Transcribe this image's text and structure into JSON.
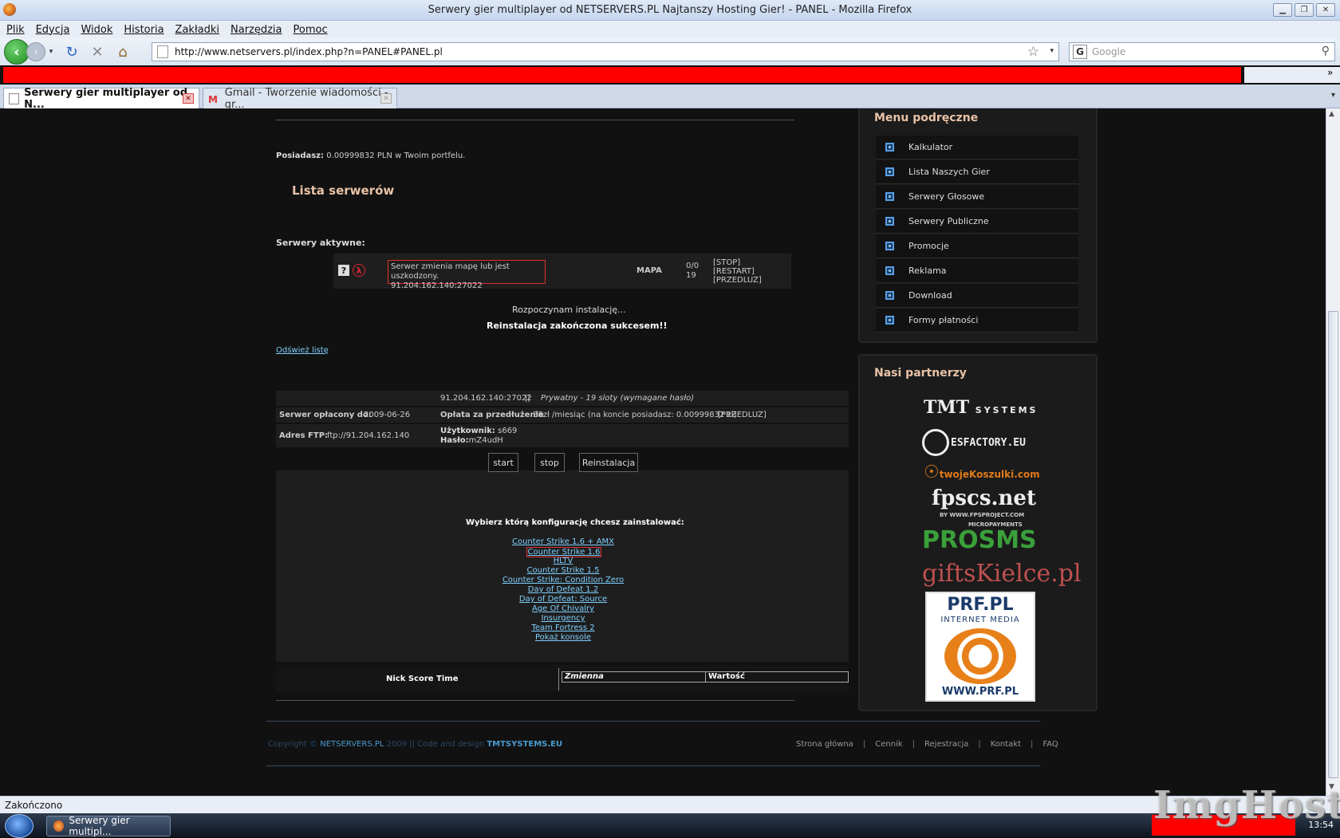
{
  "window": {
    "title": "Serwery gier multiplayer od NETSERVERS.PL Najtanszy Hosting Gier! - PANEL - Mozilla Firefox",
    "minimize": "▁",
    "maximize": "❐",
    "close": "✕"
  },
  "menu": [
    "Plik",
    "Edycja",
    "Widok",
    "Historia",
    "Zakładki",
    "Narzędzia",
    "Pomoc"
  ],
  "nav": {
    "url": "http://www.netservers.pl/index.php?n=PANEL#PANEL.pl",
    "search_placeholder": "Google",
    "bookmarks_overflow": "»"
  },
  "tabs": [
    {
      "label": "Serwery gier multiplayer od N...",
      "active": true
    },
    {
      "label": "Gmail - Tworzenie wiadomości - gr...",
      "active": false
    }
  ],
  "page": {
    "posiadasz_label": "Posiadasz:",
    "posiadasz_value": "0.00999832 PLN w Twoim portfelu.",
    "lista_title": "Lista serwerów",
    "aktywne_label": "Serwery aktywne:",
    "server": {
      "status_line1": "Serwer zmienia mapę lub jest uszkodzony.",
      "status_line2": "91.204.162.140:27022",
      "map": "MAPA",
      "players": "0/0",
      "slots": "19",
      "stop": "[STOP]",
      "restart": "[RESTART]",
      "przedluz": "[PRZEDLUZ]"
    },
    "installing": "Rozpoczynam instalację...",
    "success": "Reinstalacja zakończona sukcesem!!",
    "refresh": "Odśwież listę",
    "info": {
      "address": "91.204.162.140:27022",
      "sep": "||",
      "type": "Prywatny - 19 sloty (wymagane hasło)",
      "paid_label": "Serwer opłacony do:",
      "paid_value": "2009-06-26",
      "fee_label": "Opłata za przedłużenie",
      "fee_value": "38zł /miesiąc (na koncie posiadasz: 0.00999832 zł)",
      "fee_extend": "[PRZEDLUZ]",
      "ftp_label": "Adres FTP:",
      "ftp_value": "ftp://91.204.162.140",
      "user_label": "Użytkownik:",
      "user_value": "s669",
      "pass_label": "Hasło:",
      "pass_value": "mZ4udH"
    },
    "buttons": {
      "start": "start",
      "stop": "stop",
      "reinstall": "Reinstalacja"
    },
    "config_title": "Wybierz którą konfigurację chcesz zainstalować:",
    "configs": [
      "Counter Strike 1.6 + AMX",
      "Counter Strike 1.6",
      "HLTV",
      "Counter Strike 1.5",
      "Counter Strike: Condition Zero",
      "Day of Defeat 1.2",
      "Day of Defeat: Source",
      "Age Of Chivalry",
      "Insurgency",
      "Team Fortress 2",
      "Pokaż konsole"
    ],
    "selected_config": "Counter Strike 1.6",
    "table_left": "Nick Score Time",
    "table_col1": "Zmienna",
    "table_col2": "Wartość",
    "footer": {
      "copy_prefix": "Copyright ©",
      "brand": "NETSERVERS.PL",
      "year_text": "2009 || Code and design",
      "designer": "TMTSYSTEMS.EU",
      "links": [
        "Strona główna",
        "Cennik",
        "Rejestracja",
        "Kontakt",
        "FAQ"
      ],
      "sep": "|"
    }
  },
  "sidebar": {
    "menu_title": "Menu podręczne",
    "menu_items": [
      "Kalkulator",
      "Lista Naszych Gier",
      "Serwery Głosowe",
      "Serwery Publiczne",
      "Promocje",
      "Reklama",
      "Download",
      "Formy płatności"
    ],
    "partners_title": "Nasi partnerzy",
    "partners": {
      "tmt_a": "TMT",
      "tmt_b": "SYSTEMS",
      "esfactory": "ESFACTORY.EU",
      "koszulki": "twojeKoszulki.com",
      "fpscs": "fpscs.net",
      "fpscs_by": "BY WWW.FPSPROJECT.COM",
      "prosms_top": "MICROPAYMENTS",
      "prosms": "PROSMS",
      "gifts": "giftsKielce.pl",
      "prf_title": "PRF.PL",
      "prf_sub": "INTERNET MEDIA",
      "prf_url": "WWW.PRF.PL"
    }
  },
  "statusbar": {
    "text": "Zakończono"
  },
  "taskbar": {
    "item": "Serwery gier multipl...",
    "clock": "13:54"
  },
  "watermark": "ImgHost.pl"
}
